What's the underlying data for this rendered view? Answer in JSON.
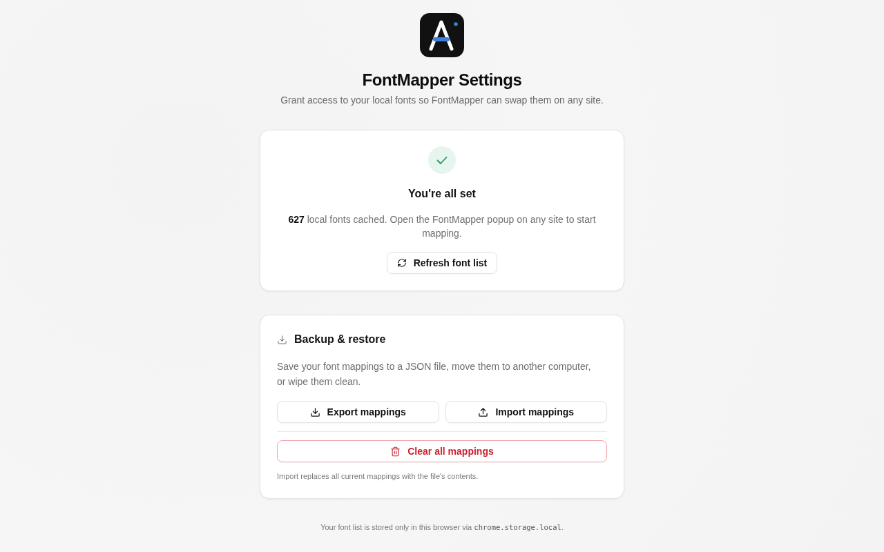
{
  "header": {
    "title": "FontMapper Settings",
    "subtitle": "Grant access to your local fonts so FontMapper can swap them on any site."
  },
  "status_card": {
    "title": "You're all set",
    "message": "**627** local fonts cached. Open the FontMapper popup on any site to start mapping.",
    "button": "Refresh font list"
  },
  "backup_card": {
    "title": "Backup & restore",
    "description": "Save your font mappings to a JSON file, move them to another computer, or wipe them clean.",
    "buttons": [
      {
        "label": "Export mappings",
        "kind": "export"
      },
      {
        "label": "Import mappings",
        "kind": "import"
      }
    ],
    "danger_button": "Clear all mappings",
    "note": "Import replaces all current mappings with the file's contents."
  },
  "footer": {
    "text": "Your font list is stored only in this browser via",
    "code": "chrome.storage.local",
    "suffix": "."
  }
}
